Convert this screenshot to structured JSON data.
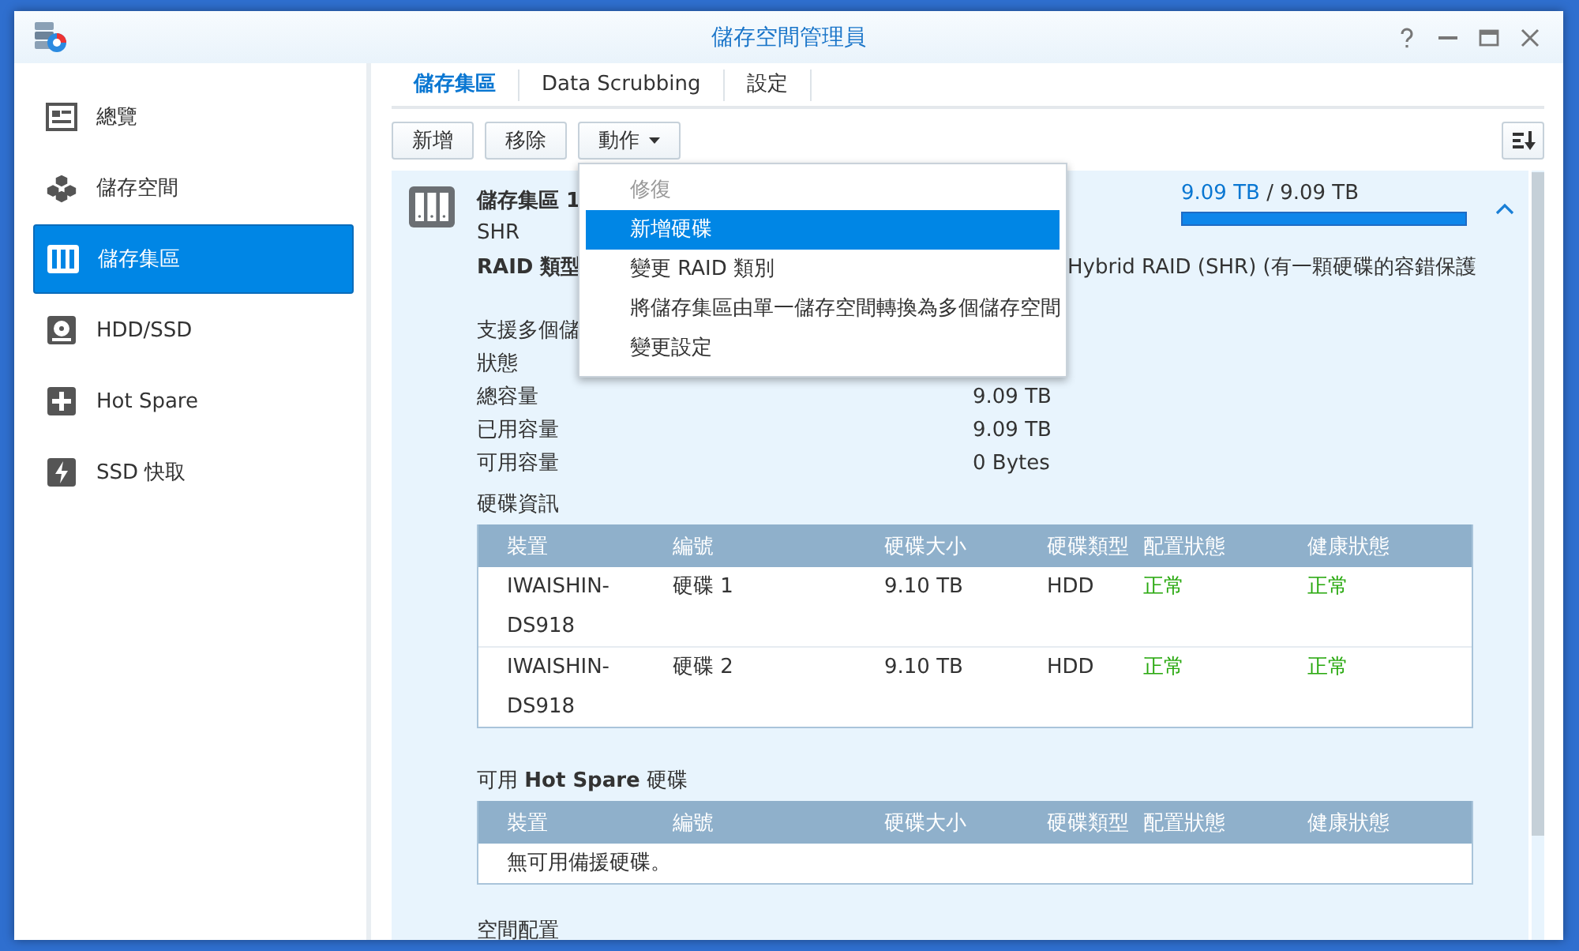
{
  "window": {
    "title": "儲存空間管理員"
  },
  "sidebar": {
    "items": [
      {
        "label": "總覽",
        "selected": false
      },
      {
        "label": "儲存空間",
        "selected": false
      },
      {
        "label": "儲存集區",
        "selected": true
      },
      {
        "label": "HDD/SSD",
        "selected": false
      },
      {
        "label": "Hot Spare",
        "selected": false
      },
      {
        "label": "SSD 快取",
        "selected": false
      }
    ]
  },
  "tabs": [
    {
      "label": "儲存集區",
      "selected": true
    },
    {
      "label": "Data Scrubbing",
      "selected": false
    },
    {
      "label": "設定",
      "selected": false
    }
  ],
  "toolbar": {
    "buttons": [
      {
        "label": "新增",
        "kind": "plain"
      },
      {
        "label": "移除",
        "kind": "plain"
      },
      {
        "label": "動作",
        "kind": "dropdown"
      }
    ]
  },
  "menu": {
    "items": [
      {
        "label": "修復",
        "disabled": true,
        "selected": false
      },
      {
        "label": "新增硬碟",
        "disabled": false,
        "selected": true
      },
      {
        "label": "變更 RAID 類別",
        "disabled": false,
        "selected": false
      },
      {
        "label": "將儲存集區由單一儲存空間轉換為多個儲存空間",
        "disabled": false,
        "selected": false
      },
      {
        "label": "變更設定",
        "disabled": false,
        "selected": false
      }
    ]
  },
  "pool": {
    "title": "儲存集區 1",
    "subtitle": "SHR",
    "used": "9.09 TB",
    "total": "/ 9.09 TB",
    "level": 1,
    "expanded": true,
    "details": [
      {
        "label": "RAID 類型",
        "value": "Hybrid RAID (SHR) (有一顆硬碟的容錯保護",
        "kind": "emphasis"
      },
      {
        "label": "支援多個儲",
        "kind": "section-start"
      },
      {
        "label": "狀態",
        "kind": "plain"
      },
      {
        "label": "總容量",
        "value": "9.09 TB",
        "kind": "plain"
      },
      {
        "label": "已用容量",
        "value": "9.09 TB",
        "kind": "plain"
      },
      {
        "label": "可用容量",
        "value": "0 Bytes",
        "kind": "plain"
      }
    ],
    "disk_info": {
      "title": "硬碟資訊",
      "columns": [
        {
          "label": "裝置",
          "kind": "text"
        },
        {
          "label": "編號",
          "kind": "text"
        },
        {
          "label": "硬碟大小",
          "kind": "text"
        },
        {
          "label": "硬碟類型",
          "kind": "text"
        },
        {
          "label": "配置狀態",
          "kind": "status"
        },
        {
          "label": "健康狀態",
          "kind": "status"
        }
      ],
      "rows": [
        [
          "IWAISHIN-DS918",
          "硬碟 1",
          "9.10 TB",
          "HDD",
          "正常",
          "正常"
        ],
        [
          "IWAISHIN-DS918",
          "硬碟 2",
          "9.10 TB",
          "HDD",
          "正常",
          "正常"
        ]
      ]
    },
    "hot_spare": {
      "title": "可用 **Hot Spare** 硬碟",
      "columns": [
        {
          "label": "裝置"
        },
        {
          "label": "編號"
        },
        {
          "label": "硬碟大小"
        },
        {
          "label": "硬碟類型"
        },
        {
          "label": "配置狀態"
        },
        {
          "label": "健康狀態"
        }
      ],
      "empty_message": "無可用備援硬碟。"
    },
    "allocation": {
      "title": "空間配置"
    }
  }
}
